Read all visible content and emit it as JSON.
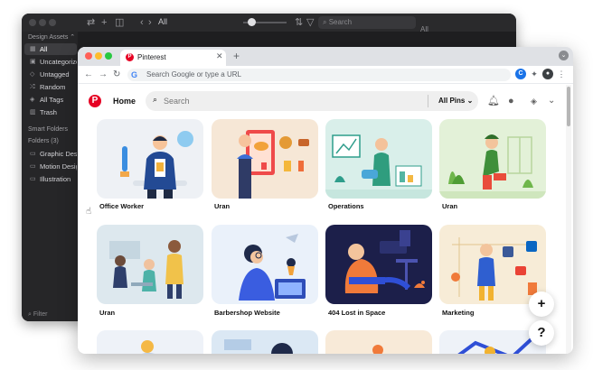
{
  "dark_app": {
    "toolbar": {
      "view_label": "All",
      "search_placeholder": "Search",
      "right_label": "All"
    },
    "sidebar": {
      "library_name": "Design Assets ⌃",
      "items": [
        {
          "label": "All",
          "icon": "grid-icon",
          "glyph": "▦"
        },
        {
          "label": "Uncategorized",
          "icon": "folder-question-icon",
          "glyph": "▣"
        },
        {
          "label": "Untagged",
          "icon": "tag-icon",
          "glyph": "◇"
        },
        {
          "label": "Random",
          "icon": "shuffle-icon",
          "glyph": "⤮"
        },
        {
          "label": "All Tags",
          "icon": "tags-icon",
          "glyph": "◈"
        },
        {
          "label": "Trash",
          "icon": "trash-icon",
          "glyph": "▥"
        }
      ],
      "smart_folders_label": "Smart Folders",
      "folders_label": "Folders (3)",
      "folders": [
        {
          "label": "Graphic Design"
        },
        {
          "label": "Motion Design"
        },
        {
          "label": "Illustration"
        }
      ],
      "filter_label": "Filter"
    }
  },
  "browser": {
    "tab": {
      "title": "Pinterest",
      "favicon": "P",
      "close": "✕",
      "new_tab": "+"
    },
    "address_bar": {
      "placeholder": "Search Google or type a URL",
      "g_glyph": "G"
    },
    "nav": {
      "back": "←",
      "forward": "→",
      "reload": "↻"
    },
    "extensions": {
      "c_glyph": "C",
      "puzzle_glyph": "✦",
      "avatar_glyph": "●",
      "menu_glyph": "⋮"
    },
    "menu_dot": "⌄"
  },
  "pinterest": {
    "logo": "P",
    "home_label": "Home",
    "search_placeholder": "Search",
    "all_pins_label": "All Pins ⌄",
    "header_icons": [
      "bell-icon",
      "chat-icon",
      "layers-icon",
      "chevron-down-icon"
    ],
    "pins_row1": [
      {
        "label": "Office Worker",
        "bg": "#eef1f5"
      },
      {
        "label": "Uran",
        "bg": "#f6e7d6"
      },
      {
        "label": "Operations",
        "bg": "#d9efea"
      },
      {
        "label": "Uran",
        "bg": "#e3f1d8"
      }
    ],
    "pins_row2": [
      {
        "label": "Uran",
        "bg": "#dde8ee"
      },
      {
        "label": "Barbershop Website",
        "bg": "#eaf1fa"
      },
      {
        "label": "404 Lost in Space",
        "bg": "#1c1f4a"
      },
      {
        "label": "Marketing",
        "bg": "#f7ecd7"
      }
    ],
    "pins_row3_bg": [
      "#eef2f8",
      "#dbe8f4",
      "#f8ead8",
      "#eef2f8"
    ],
    "fab_add": "+",
    "fab_help": "?"
  },
  "colors": {
    "pinterest_red": "#e60023",
    "dark_bg": "#1f1f21"
  }
}
